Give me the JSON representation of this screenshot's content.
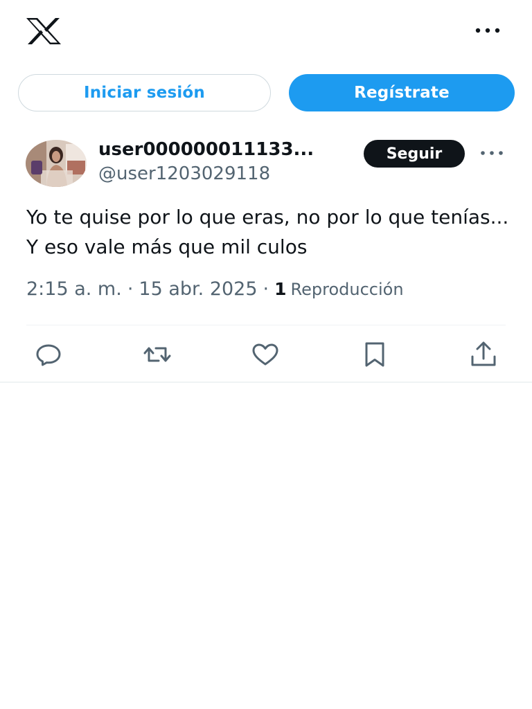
{
  "header": {
    "logo_icon": "x-logo-icon",
    "more_icon": "more-horizontal-icon"
  },
  "auth": {
    "login_label": "Iniciar sesión",
    "signup_label": "Regístrate"
  },
  "post": {
    "author": {
      "display_name": "user000000011133...",
      "handle": "@user1203029118",
      "avatar_icon": "avatar-photo"
    },
    "follow_label": "Seguir",
    "text": "Yo te quise por lo que eras, no por lo que tenías... Y eso vale más que mil culos",
    "time": "2:15 a. m.",
    "date": "15 abr. 2025",
    "separator": "·",
    "views_count": "1",
    "views_label": "Reproducción"
  },
  "actions": [
    {
      "name": "reply",
      "icon": "reply-icon"
    },
    {
      "name": "repost",
      "icon": "repost-icon"
    },
    {
      "name": "like",
      "icon": "heart-icon"
    },
    {
      "name": "bookmark",
      "icon": "bookmark-icon"
    },
    {
      "name": "share",
      "icon": "share-icon"
    }
  ],
  "colors": {
    "accent": "#1d9bf0",
    "text_primary": "#0f1419",
    "text_secondary": "#536471",
    "border": "#cfd9de",
    "divider": "#eff3f4"
  }
}
